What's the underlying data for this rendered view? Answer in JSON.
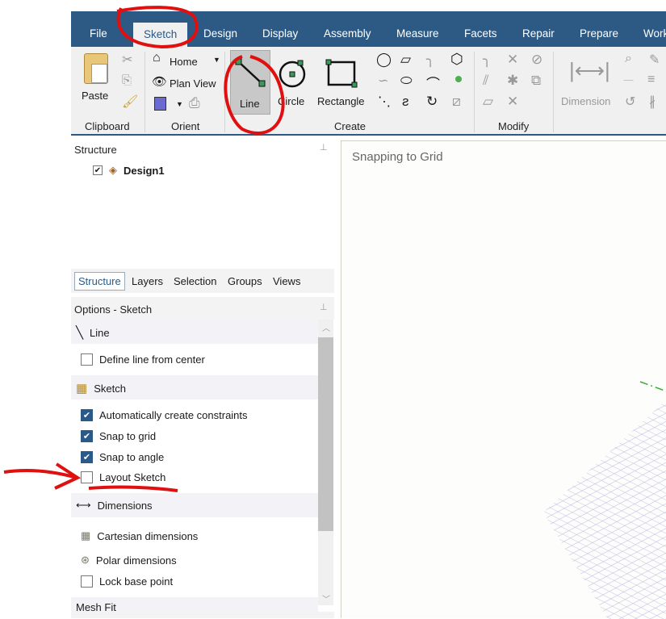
{
  "menu_tabs": [
    "File",
    "Sketch",
    "Design",
    "Display",
    "Assembly",
    "Measure",
    "Facets",
    "Repair",
    "Prepare",
    "Work"
  ],
  "ribbon": {
    "clipboard": {
      "paste": "Paste",
      "group": "Clipboard"
    },
    "orient": {
      "home": "Home",
      "plan_view": "Plan View",
      "group": "Orient"
    },
    "create": {
      "line": "Line",
      "circle": "Circle",
      "rectangle": "Rectangle",
      "group": "Create"
    },
    "modify": {
      "group": "Modify"
    },
    "dimension": {
      "label": "Dimension"
    }
  },
  "structure": {
    "title": "Structure",
    "tree": [
      {
        "label": "Design1",
        "checked": true
      }
    ]
  },
  "panel_tabs": [
    "Structure",
    "Layers",
    "Selection",
    "Groups",
    "Views"
  ],
  "options": {
    "title": "Options - Sketch",
    "line_section": "Line",
    "define_line_from_center": "Define line from center",
    "sketch_section": "Sketch",
    "auto_constraints": "Automatically create constraints",
    "snap_grid": "Snap to grid",
    "snap_angle": "Snap to angle",
    "layout_sketch": "Layout Sketch",
    "dimensions_section": "Dimensions",
    "cartesian": "Cartesian dimensions",
    "polar": "Polar dimensions",
    "lock_base": "Lock base point",
    "mesh_fit": "Mesh Fit"
  },
  "viewport": {
    "status": "Snapping to Grid"
  },
  "colors": {
    "accent": "#2c5a85",
    "annotation": "#e01010"
  }
}
